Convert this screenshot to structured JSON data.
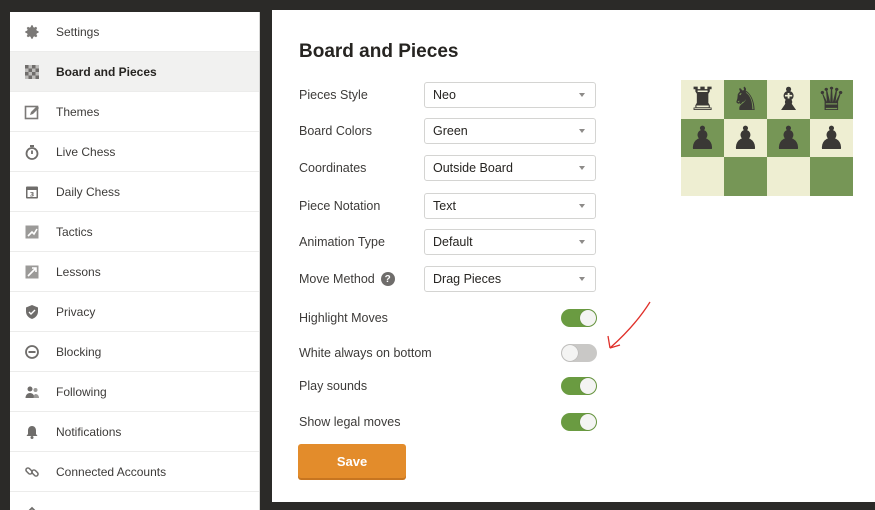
{
  "sidebar": {
    "items": [
      {
        "label": "Settings",
        "icon": "gear-icon"
      },
      {
        "label": "Board and Pieces",
        "icon": "checkerboard-icon",
        "active": true
      },
      {
        "label": "Themes",
        "icon": "edit-icon"
      },
      {
        "label": "Live Chess",
        "icon": "stopwatch-icon"
      },
      {
        "label": "Daily Chess",
        "icon": "calendar-icon"
      },
      {
        "label": "Tactics",
        "icon": "tactics-icon"
      },
      {
        "label": "Lessons",
        "icon": "lessons-icon"
      },
      {
        "label": "Privacy",
        "icon": "shield-icon"
      },
      {
        "label": "Blocking",
        "icon": "block-icon"
      },
      {
        "label": "Following",
        "icon": "users-icon"
      },
      {
        "label": "Notifications",
        "icon": "bell-icon"
      },
      {
        "label": "Connected Accounts",
        "icon": "link-icon"
      }
    ]
  },
  "main": {
    "title": "Board and Pieces",
    "selects": [
      {
        "label": "Pieces Style",
        "value": "Neo"
      },
      {
        "label": "Board Colors",
        "value": "Green"
      },
      {
        "label": "Coordinates",
        "value": "Outside Board"
      },
      {
        "label": "Piece Notation",
        "value": "Text"
      },
      {
        "label": "Animation Type",
        "value": "Default"
      },
      {
        "label": "Move Method",
        "value": "Drag Pieces",
        "help": "?"
      }
    ],
    "toggles": [
      {
        "label": "Highlight Moves",
        "on": true
      },
      {
        "label": "White always on bottom",
        "on": false
      },
      {
        "label": "Play sounds",
        "on": true
      },
      {
        "label": "Show legal moves",
        "on": true
      }
    ],
    "save_label": "Save"
  },
  "board_preview": {
    "rows": [
      [
        "♜",
        "♞",
        "♝",
        "♛"
      ],
      [
        "♟",
        "♟",
        "♟",
        "♟"
      ],
      [
        "",
        "",
        "",
        ""
      ]
    ],
    "colors": {
      "light": "#eeeed2",
      "dark": "#769656"
    }
  },
  "colors": {
    "toggle_on": "#6a9b41",
    "toggle_off": "#c9c8c6",
    "save": "#e38c2b",
    "annotation": "#e0302a"
  }
}
